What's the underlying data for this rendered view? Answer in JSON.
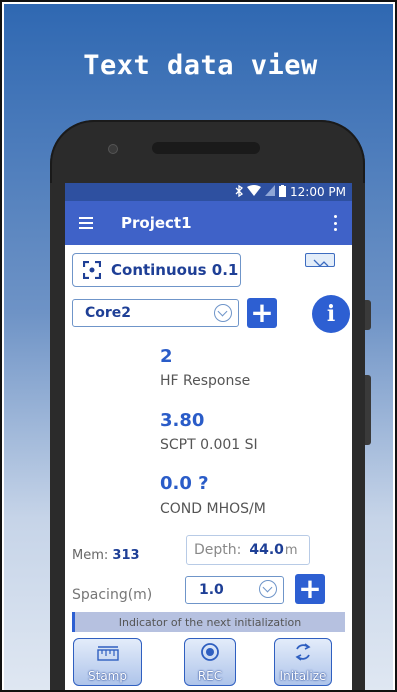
{
  "headline": "Text data view",
  "status_bar": {
    "time": "12:00 PM",
    "icons": [
      "bluetooth-icon",
      "wifi-icon",
      "signal-icon",
      "battery-icon"
    ]
  },
  "app_bar": {
    "title": "Project1",
    "menu_icon": "hamburger-menu-icon",
    "more_icon": "vertical-more-icon"
  },
  "mode_button": {
    "icon": "focus-icon",
    "label": "Continuous 0.1"
  },
  "sensor_select": {
    "selected": "Core2"
  },
  "readings": [
    {
      "value": "2",
      "label": "HF Response"
    },
    {
      "value": "3.80",
      "label": "SCPT 0.001 SI"
    },
    {
      "value": "0.0 ?",
      "label": "COND MHOS/M"
    }
  ],
  "memory": {
    "label": "Mem:",
    "value": "313"
  },
  "depth": {
    "label": "Depth:",
    "value": "44.0",
    "unit": "m"
  },
  "spacing": {
    "label": "Spacing(m)",
    "selected": "1.0"
  },
  "indicator": {
    "text": "Indicator of the next initialization"
  },
  "bottom_buttons": [
    {
      "label": "Stamp",
      "icon": "ruler-icon"
    },
    {
      "label": "REC",
      "icon": "record-icon"
    },
    {
      "label": "Initalize",
      "icon": "refresh-icon"
    }
  ],
  "colors": {
    "accent": "#2d5fd2",
    "app_bar": "#3f62c8",
    "status_bar": "#2e50a0",
    "value_text": "#2a5cc8"
  }
}
